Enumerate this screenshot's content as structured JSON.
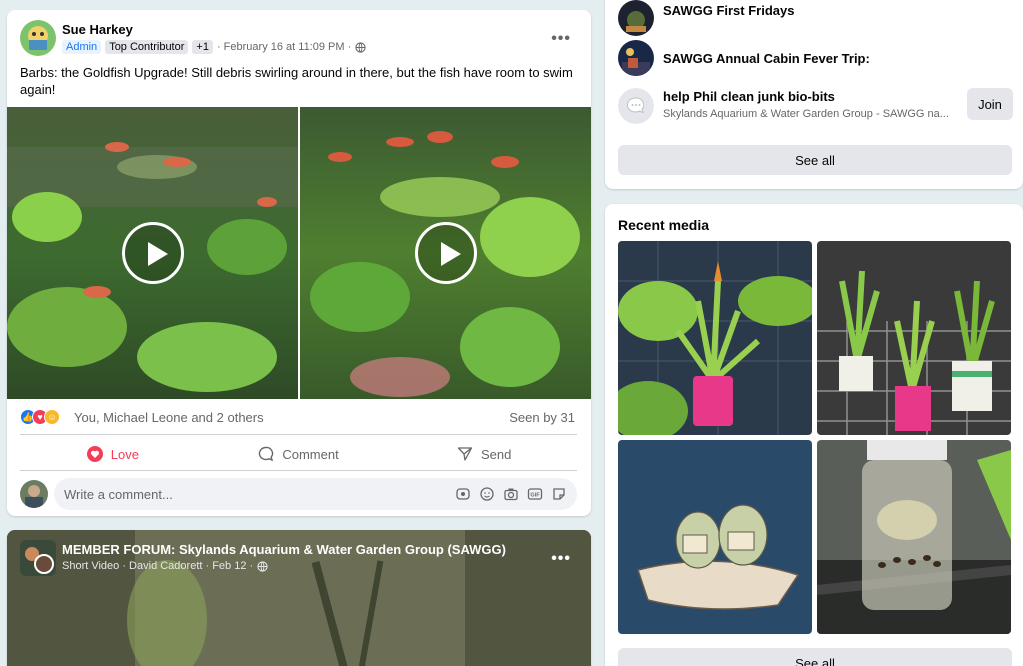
{
  "post1": {
    "author": "Sue Harkey",
    "badges": [
      "Admin",
      "Top Contributor",
      "+1"
    ],
    "timestamp": "· February 16 at 11:09 PM ·",
    "text": "Barbs: the Goldfish Upgrade! Still debris swirling around in there, but the fish have room to swim again!",
    "reactions_text": "You, Michael Leone and 2 others",
    "seen": "Seen by 31",
    "actions": {
      "love": "Love",
      "comment": "Comment",
      "send": "Send"
    },
    "comment_placeholder": "Write a comment..."
  },
  "post2": {
    "title": "MEMBER FORUM: Skylands Aquarium & Water Garden Group (SAWGG)",
    "meta": "Short Video · David Cadorett · Feb 12 ·"
  },
  "events": {
    "items": [
      {
        "title": "SAWGG First Fridays"
      },
      {
        "title": "SAWGG Annual Cabin Fever Trip:"
      },
      {
        "title": "help Phil clean junk bio-bits",
        "subtitle": "Skylands Aquarium & Water Garden Group - SAWGG na...",
        "button": "Join"
      }
    ],
    "see_all": "See all"
  },
  "recent_media": {
    "title": "Recent media",
    "see_all": "See all"
  },
  "colors": {
    "love": "#f33e58",
    "accent": "#1877f2"
  }
}
